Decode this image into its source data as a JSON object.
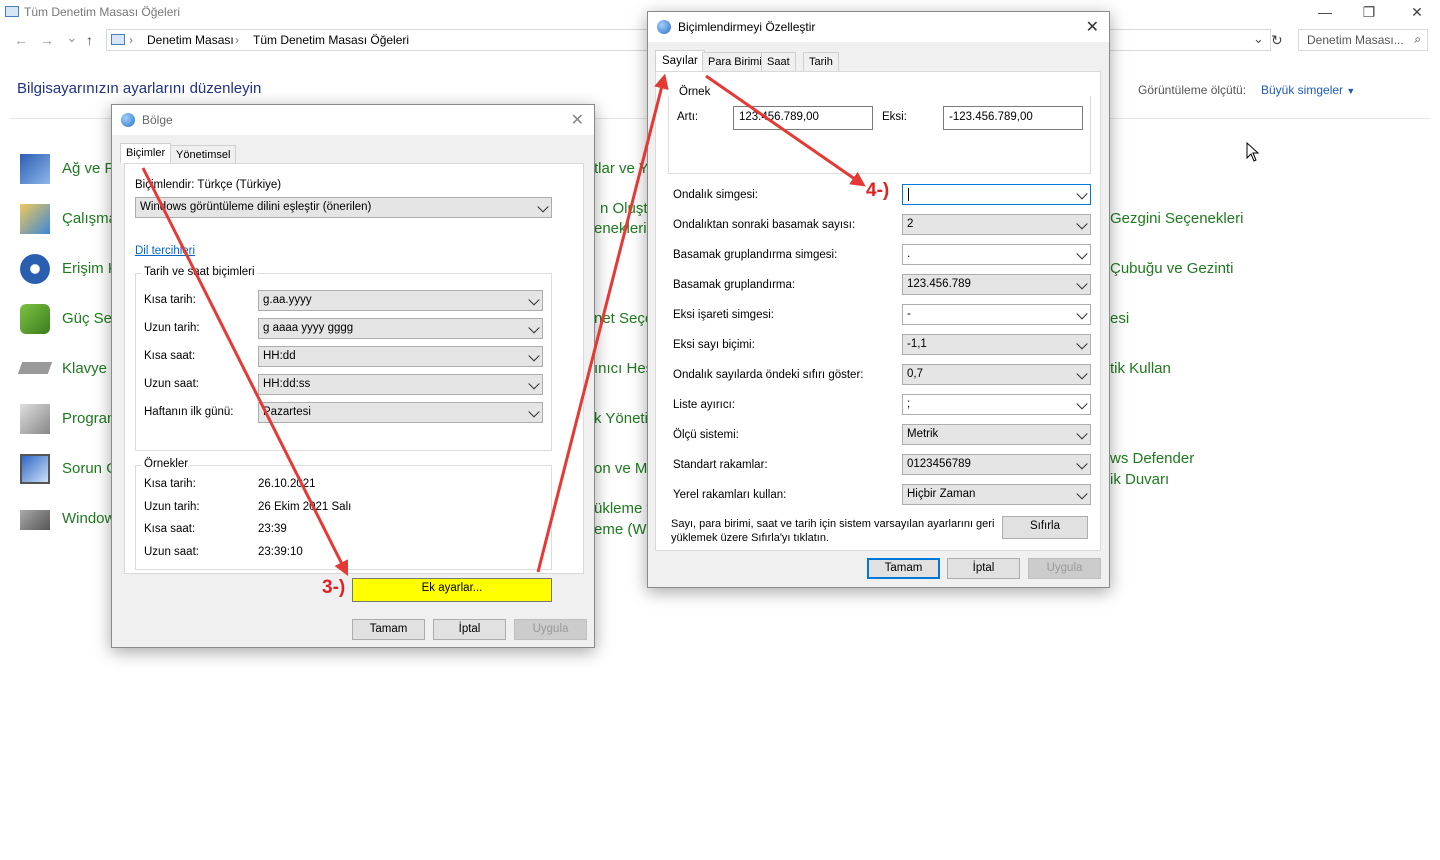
{
  "window": {
    "title": "Tüm Denetim Masası Öğeleri",
    "minimize": "—",
    "restore": "❐",
    "close": "✕"
  },
  "nav": {
    "back": "←",
    "forward": "→",
    "recent": "⌄",
    "up": "↑",
    "breadcrumb": [
      "Denetim Masası",
      "Tüm Denetim Masası Öğeleri"
    ],
    "search_placeholder": "Denetim Masası..."
  },
  "control_panel": {
    "heading": "Bilgisayarınızın ayarlarını düzenleyin",
    "view_by_label": "Görüntüleme ölçütü:",
    "view_by_value": "Büyük simgeler",
    "col1": [
      "Ağ ve P",
      "Çalışma",
      "Erişim K",
      "Güç Seç",
      "Klavye",
      "Program",
      "Sorun G",
      "Window"
    ],
    "col2": [
      "tlar ve Y",
      "n Oluştu",
      "enekleri",
      "net Seçe",
      "ınıcı Hes",
      "k Yöneti",
      "on ve M",
      "ükleme v",
      "eme (Wi"
    ],
    "col3": [
      "Gezgini Seçenekleri",
      "Çubuğu ve Gezinti",
      "esi",
      "tik Kullan",
      "ws Defender",
      "ik Duvarı"
    ]
  },
  "region": {
    "title": "Bölge",
    "tabs": [
      "Biçimler",
      "Yönetimsel"
    ],
    "format_label": "Biçimlendir: Türkçe (Türkiye)",
    "format_value": "Windows görüntüleme dilini eşleştir (önerilen)",
    "lang_link": "Dil tercihleri",
    "group_datetime": "Tarih ve saat biçimleri",
    "rows": [
      {
        "label": "Kısa tarih:",
        "value": "g.aa.yyyy"
      },
      {
        "label": "Uzun tarih:",
        "value": "g aaaa yyyy gggg"
      },
      {
        "label": "Kısa saat:",
        "value": "HH:dd"
      },
      {
        "label": "Uzun saat:",
        "value": "HH:dd:ss"
      },
      {
        "label": "Haftanın ilk günü:",
        "value": "Pazartesi"
      }
    ],
    "group_examples": "Örnekler",
    "examples": [
      {
        "label": "Kısa tarih:",
        "value": "26.10.2021"
      },
      {
        "label": "Uzun tarih:",
        "value": "26 Ekim 2021 Salı"
      },
      {
        "label": "Kısa saat:",
        "value": "23:39"
      },
      {
        "label": "Uzun saat:",
        "value": "23:39:10"
      }
    ],
    "additional_button": "Ek ayarlar...",
    "ok": "Tamam",
    "cancel": "İptal",
    "apply": "Uygula"
  },
  "customize": {
    "title": "Biçimlendirmeyi Özelleştir",
    "tabs": [
      "Sayılar",
      "Para Birimi",
      "Saat",
      "Tarih"
    ],
    "example_group": "Örnek",
    "positive_label": "Artı:",
    "positive_value": "123.456.789,00",
    "negative_label": "Eksi:",
    "negative_value": "-123.456.789,00",
    "settings": [
      {
        "label": "Ondalık simgesi:",
        "value": ""
      },
      {
        "label": "Ondalıktan sonraki basamak sayısı:",
        "value": "2"
      },
      {
        "label": "Basamak gruplandırma simgesi:",
        "value": "."
      },
      {
        "label": "Basamak gruplandırma:",
        "value": "123.456.789"
      },
      {
        "label": "Eksi işareti simgesi:",
        "value": "-"
      },
      {
        "label": "Eksi sayı biçimi:",
        "value": "-1,1"
      },
      {
        "label": "Ondalık sayılarda öndeki sıfırı göster:",
        "value": "0,7"
      },
      {
        "label": "Liste ayırıcı:",
        "value": ";"
      },
      {
        "label": "Ölçü sistemi:",
        "value": "Metrik"
      },
      {
        "label": "Standart rakamlar:",
        "value": "0123456789"
      },
      {
        "label": "Yerel rakamları kullan:",
        "value": "Hiçbir Zaman"
      }
    ],
    "reset_text": "Sayı, para birimi, saat ve tarih için sistem varsayılan ayarlarını geri yüklemek üzere Sıfırla'yı tıklatın.",
    "reset_button": "Sıfırla",
    "ok": "Tamam",
    "cancel": "İptal",
    "apply": "Uygula"
  },
  "annotations": {
    "step3": "3-)",
    "step4": "4-)",
    "arrow_color": "#e53935",
    "highlight_color": "#ffff00"
  }
}
